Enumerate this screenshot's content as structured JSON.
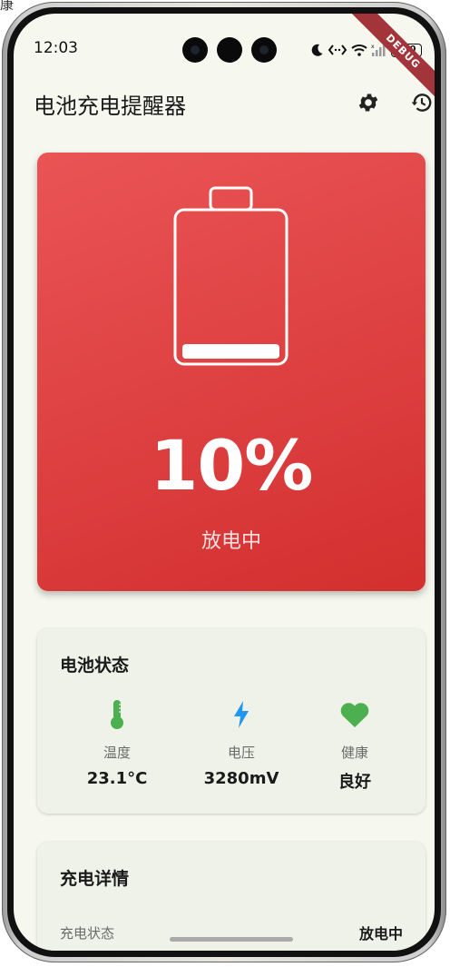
{
  "window_fragment": "康",
  "status_bar": {
    "time": "12:03",
    "battery_level": "100"
  },
  "debug_banner": "DEBUG",
  "app_bar": {
    "title": "电池充电提醒器",
    "actions": [
      "settings-icon",
      "history-icon"
    ]
  },
  "battery_card": {
    "percent": "10%",
    "level_fraction": 0.1,
    "state": "放电中",
    "colors": {
      "start": "#ea5455",
      "end": "#d32f2f"
    }
  },
  "status_card": {
    "title": "电池状态",
    "stats": [
      {
        "label": "温度",
        "value": "23.1°C",
        "icon": "thermometer-icon",
        "color": "#4caf50"
      },
      {
        "label": "电压",
        "value": "3280mV",
        "icon": "bolt-icon",
        "color": "#2196f3"
      },
      {
        "label": "健康",
        "value": "良好",
        "icon": "heart-icon",
        "color": "#4caf50"
      }
    ]
  },
  "detail_card": {
    "title": "充电详情",
    "rows": [
      {
        "label": "充电状态",
        "value": "放电中"
      }
    ]
  }
}
